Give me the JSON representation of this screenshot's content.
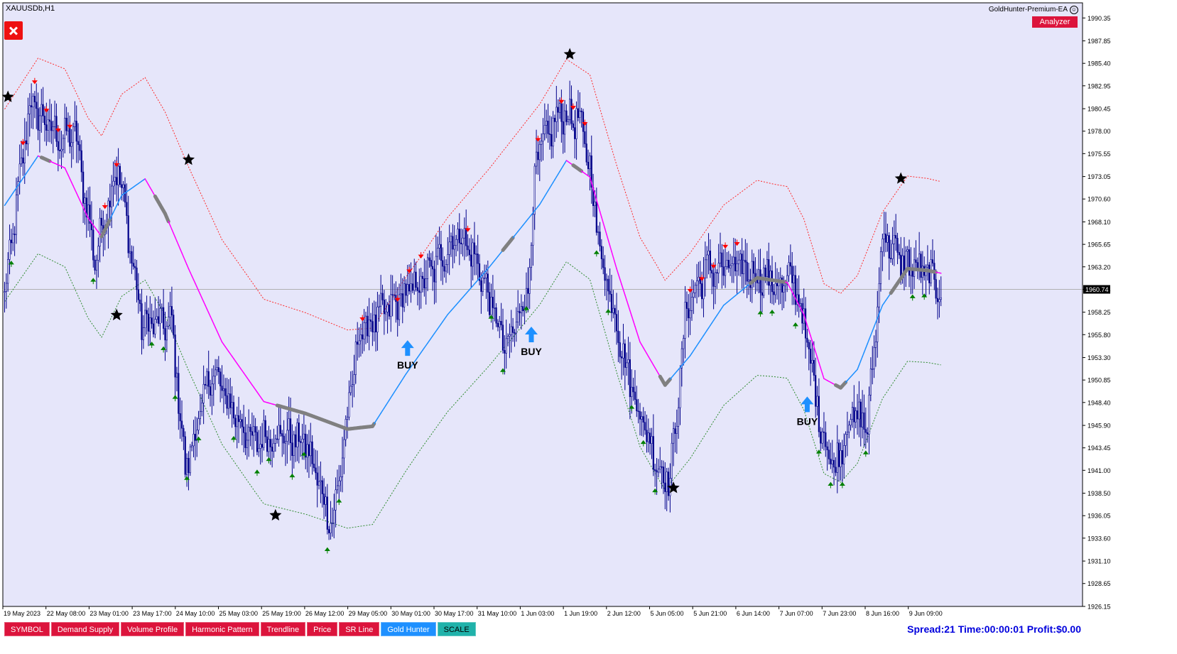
{
  "window": {
    "symbol_title": "XAUUSDb,H1",
    "ea_name": "GoldHunter-Premium-EA",
    "smile_icon": "smile-icon",
    "close_icon": "close-icon"
  },
  "analyzer_button": "Analyzer",
  "toolbar": [
    {
      "label": "SYMBOL",
      "color": "#dc143c"
    },
    {
      "label": "Demand Supply",
      "color": "#dc143c"
    },
    {
      "label": "Volume Profile",
      "color": "#dc143c"
    },
    {
      "label": "Harmonic Pattern",
      "color": "#dc143c"
    },
    {
      "label": "Trendline",
      "color": "#dc143c"
    },
    {
      "label": "Price",
      "color": "#dc143c"
    },
    {
      "label": "SR Line",
      "color": "#dc143c"
    },
    {
      "label": "Gold Hunter",
      "color": "#1e90ff"
    },
    {
      "label": "SCALE",
      "color": "#20b2aa"
    }
  ],
  "status_line": "Spread:21 Time:00:00:01 Profit:$0.00",
  "colors": {
    "background": "#e6e6fa",
    "up_band": "#ff2a2a",
    "down_band": "#2e8b2e",
    "mid_up": "#1e90ff",
    "mid_down": "#ff00ff",
    "flat": "#808080",
    "candle": "#00008b",
    "buy": "#1e90ff",
    "star_top": "#ff1493",
    "star_bottom": "#1e90ff"
  },
  "chart_data": {
    "type": "candlestick",
    "symbol": "XAUUSDb",
    "timeframe": "H1",
    "y_range": [
      1926.15,
      1992.0
    ],
    "y_ticks": [
      "1990.35",
      "1987.85",
      "1985.40",
      "1982.95",
      "1980.45",
      "1978.00",
      "1975.55",
      "1973.05",
      "1970.60",
      "1968.10",
      "1965.65",
      "1963.20",
      "1960.74",
      "1958.25",
      "1955.80",
      "1953.30",
      "1950.85",
      "1948.40",
      "1945.90",
      "1943.45",
      "1941.00",
      "1938.50",
      "1936.05",
      "1933.60",
      "1931.10",
      "1928.65",
      "1926.15"
    ],
    "current_price": "1960.74",
    "x_labels": [
      "19 May 2023",
      "22 May 08:00",
      "23 May 01:00",
      "23 May 17:00",
      "24 May 10:00",
      "25 May 03:00",
      "25 May 19:00",
      "26 May 12:00",
      "29 May 05:00",
      "30 May 01:00",
      "30 May 17:00",
      "31 May 10:00",
      "1 Jun 03:00",
      "1 Jun 19:00",
      "2 Jun 12:00",
      "5 Jun 05:00",
      "5 Jun 21:00",
      "6 Jun 14:00",
      "7 Jun 07:00",
      "7 Jun 23:00",
      "8 Jun 16:00",
      "9 Jun 09:00"
    ],
    "anchors": [
      [
        0,
        1960
      ],
      [
        15,
        1981
      ],
      [
        34,
        1977
      ],
      [
        42,
        1978
      ],
      [
        54,
        1964
      ],
      [
        64,
        1972
      ],
      [
        68,
        1974
      ],
      [
        82,
        1957
      ],
      [
        100,
        1957
      ],
      [
        108,
        1941
      ],
      [
        124,
        1952
      ],
      [
        132,
        1949
      ],
      [
        148,
        1944
      ],
      [
        164,
        1945
      ],
      [
        180,
        1944
      ],
      [
        196,
        1935
      ],
      [
        212,
        1956
      ],
      [
        232,
        1959
      ],
      [
        252,
        1962
      ],
      [
        272,
        1967
      ],
      [
        284,
        1963
      ],
      [
        300,
        1954
      ],
      [
        313,
        1961
      ],
      [
        318,
        1975
      ],
      [
        332,
        1980
      ],
      [
        344,
        1979
      ],
      [
        350,
        1974
      ],
      [
        356,
        1965
      ],
      [
        365,
        1958
      ],
      [
        372,
        1952
      ],
      [
        382,
        1946
      ],
      [
        392,
        1941
      ],
      [
        398,
        1940
      ],
      [
        408,
        1959
      ],
      [
        420,
        1963
      ],
      [
        440,
        1963
      ],
      [
        456,
        1962
      ],
      [
        465,
        1961
      ],
      [
        472,
        1962
      ],
      [
        478,
        1957
      ],
      [
        488,
        1946
      ],
      [
        496,
        1941
      ],
      [
        506,
        1947
      ],
      [
        516,
        1946
      ],
      [
        520,
        1954
      ],
      [
        525,
        1967
      ],
      [
        535,
        1964
      ],
      [
        545,
        1963
      ],
      [
        555,
        1962
      ],
      [
        560,
        1960
      ]
    ],
    "mid_line": [
      [
        0,
        1969.9
      ],
      [
        20,
        1975.3
      ],
      [
        36,
        1974.0
      ],
      [
        50,
        1968.5
      ],
      [
        58,
        1966.5
      ],
      [
        70,
        1971.0
      ],
      [
        84,
        1972.8
      ],
      [
        96,
        1969.0
      ],
      [
        110,
        1963.0
      ],
      [
        130,
        1955.0
      ],
      [
        155,
        1948.5
      ],
      [
        180,
        1947.2
      ],
      [
        205,
        1945.5
      ],
      [
        220,
        1945.8
      ],
      [
        240,
        1951.5
      ],
      [
        265,
        1958.0
      ],
      [
        290,
        1963.2
      ],
      [
        320,
        1970.0
      ],
      [
        336,
        1974.8
      ],
      [
        350,
        1973.0
      ],
      [
        366,
        1963.0
      ],
      [
        380,
        1955.0
      ],
      [
        395,
        1950.3
      ],
      [
        410,
        1953.5
      ],
      [
        430,
        1959.0
      ],
      [
        450,
        1962.0
      ],
      [
        468,
        1961.5
      ],
      [
        478,
        1958.0
      ],
      [
        490,
        1951.0
      ],
      [
        500,
        1950.0
      ],
      [
        510,
        1952.0
      ],
      [
        525,
        1959.0
      ],
      [
        540,
        1963.0
      ],
      [
        552,
        1962.8
      ],
      [
        560,
        1962.5
      ]
    ],
    "band_offset": [
      [
        0,
        10.5
      ],
      [
        60,
        11.0
      ],
      [
        150,
        11.2
      ],
      [
        250,
        10.5
      ],
      [
        330,
        11.0
      ],
      [
        390,
        11.5
      ],
      [
        460,
        10.5
      ],
      [
        560,
        10.0
      ]
    ],
    "flat_segments": [
      [
        22,
        26
      ],
      [
        58,
        62
      ],
      [
        90,
        97
      ],
      [
        163,
        220
      ],
      [
        298,
        303
      ],
      [
        340,
        344
      ],
      [
        392,
        397
      ],
      [
        446,
        466
      ],
      [
        497,
        502
      ],
      [
        530,
        556
      ]
    ],
    "stars": [
      {
        "i": 2,
        "pos": "top"
      },
      {
        "i": 110,
        "pos": "top"
      },
      {
        "i": 67,
        "pos": "bottom"
      },
      {
        "i": 162,
        "pos": "bottom"
      },
      {
        "i": 338,
        "pos": "top"
      },
      {
        "i": 400,
        "pos": "bottom"
      },
      {
        "i": 536,
        "pos": "top"
      }
    ],
    "buy_signals": [
      {
        "i": 241,
        "label": "BUY"
      },
      {
        "i": 315,
        "label": "BUY"
      },
      {
        "i": 480,
        "label": "BUY"
      }
    ]
  }
}
